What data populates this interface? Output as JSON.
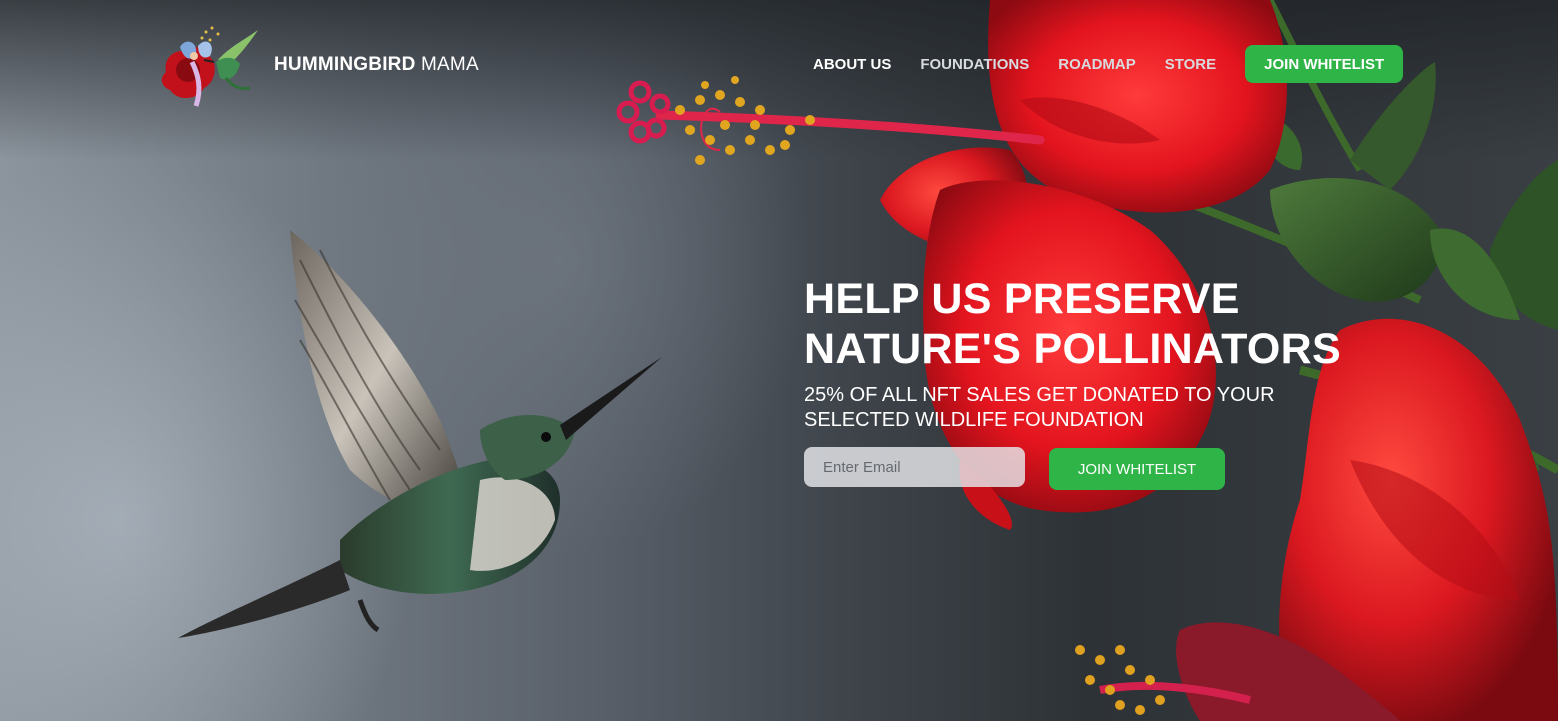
{
  "brand": {
    "name_bold": "HUMMINGBIRD",
    "name_light": "MAMA"
  },
  "nav": {
    "items": [
      {
        "label": "ABOUT US"
      },
      {
        "label": "FOUNDATIONS"
      },
      {
        "label": "ROADMAP"
      },
      {
        "label": "STORE"
      }
    ],
    "cta_label": "JOIN WHITELIST"
  },
  "hero": {
    "headline_line1": "HELP US PRESERVE",
    "headline_line2": "NATURE'S POLLINATORS",
    "subheadline": "25% OF ALL NFT SALES GET DONATED TO YOUR SELECTED WILDLIFE FOUNDATION",
    "email_placeholder": "Enter Email",
    "email_value": "",
    "cta_label": "JOIN WHITELIST"
  },
  "colors": {
    "accent_green": "#2fb447",
    "hibiscus_red": "#e3141e",
    "text_white": "#ffffff"
  },
  "icons": {
    "logo": "fairy-hummingbird-logo",
    "background": "hummingbird-hibiscus-photo"
  }
}
